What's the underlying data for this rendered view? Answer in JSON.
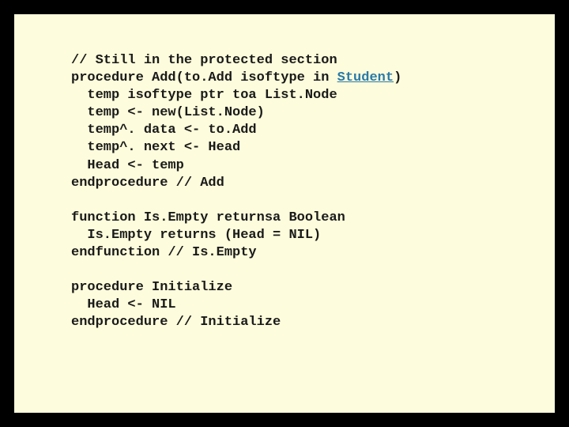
{
  "code": {
    "l1": "// Still in the protected section",
    "l2a": "procedure Add(to.Add isoftype in ",
    "l2b": "Student",
    "l2c": ")",
    "l3": "  temp isoftype ptr toa List.Node",
    "l4": "  temp <- new(List.Node)",
    "l5": "  temp^. data <- to.Add",
    "l6": "  temp^. next <- Head",
    "l7": "  Head <- temp",
    "l8": "endprocedure // Add",
    "l9": "",
    "l10": "function Is.Empty returnsa Boolean",
    "l11": "  Is.Empty returns (Head = NIL)",
    "l12": "endfunction // Is.Empty",
    "l13": "",
    "l14": "procedure Initialize",
    "l15": "  Head <- NIL",
    "l16": "endprocedure // Initialize"
  }
}
